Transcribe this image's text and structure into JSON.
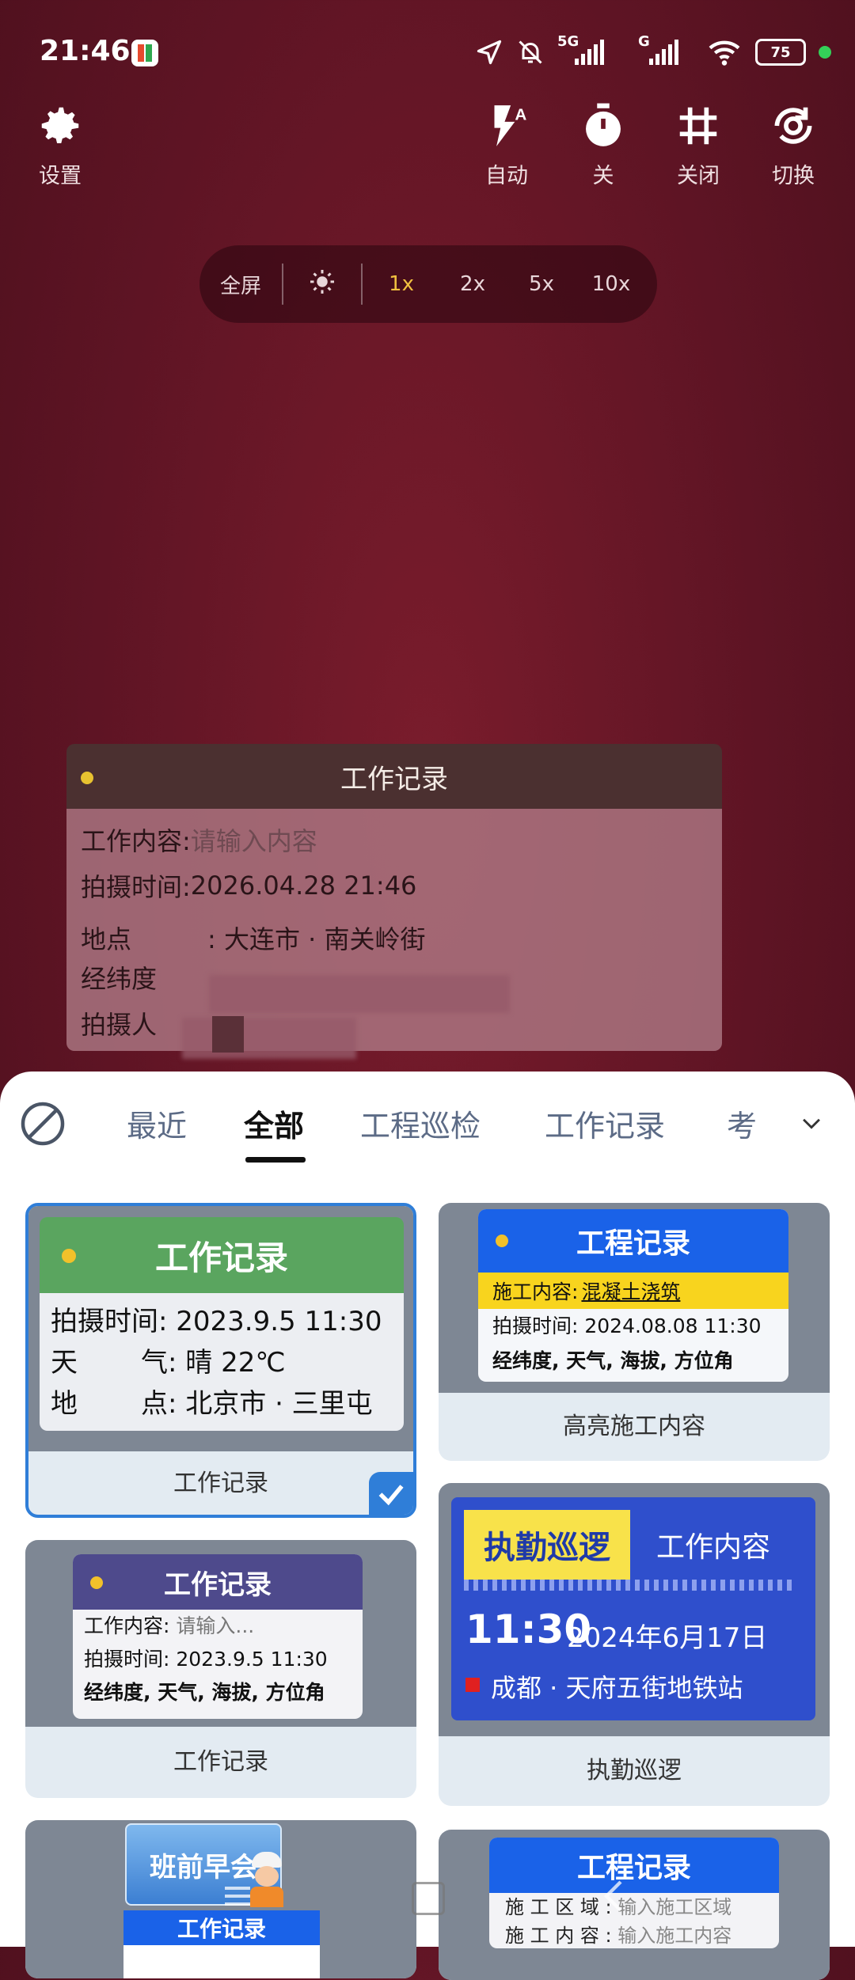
{
  "status_bar": {
    "time": "21:46",
    "net1": "5G",
    "net2": "G",
    "battery": "75"
  },
  "toolbar": {
    "settings": "设置",
    "flash": "自动",
    "timer": "关",
    "grid": "关闭",
    "switch": "切换"
  },
  "zoom": {
    "fullscreen": "全屏",
    "levels": [
      "1x",
      "2x",
      "5x",
      "10x"
    ],
    "selected": "1x"
  },
  "watermark": {
    "title": "工作记录",
    "content_label": "工作内容:",
    "content_placeholder": "请输入内容",
    "time_label": "拍摄时间:",
    "time_value": "2026.04.28 21:46",
    "place_label": "地点",
    "place_value": ": 大连市 · 南关岭街",
    "coords_label": "经纬度",
    "photographer_label": "拍摄人"
  },
  "tabs": [
    "最近",
    "全部",
    "工程巡检",
    "工作记录",
    "考"
  ],
  "active_tab": "全部",
  "templates": {
    "card1": {
      "title": "工作记录",
      "r1": "拍摄时间: 2023.9.5 11:30",
      "r2k": "天",
      "r2v": "气: 晴 22℃",
      "r3k": "地",
      "r3v": "点: 北京市 · 三里屯",
      "caption": "工作记录"
    },
    "card2": {
      "title": "工程记录",
      "hl_label": "施工内容:",
      "hl_value": "混凝土浇筑",
      "r1": "拍摄时间: 2024.08.08 11:30",
      "r2": "经纬度, 天气, 海拔, 方位角",
      "caption": "高亮施工内容"
    },
    "card3": {
      "title": "工作记录",
      "r1k": "工作内容:",
      "r1v": "请输入...",
      "r2": "拍摄时间: 2023.9.5 11:30",
      "r3": "经纬度, 天气, 海拔, 方位角",
      "caption": "工作记录"
    },
    "card4": {
      "title": "执勤巡逻",
      "right": "工作内容",
      "time": "11:30",
      "date": "2024年6月17日",
      "place": "成都 · 天府五街地铁站",
      "caption": "执勤巡逻"
    },
    "card5": {
      "badge": "班前早会",
      "title": "工作记录"
    },
    "card6": {
      "title": "工程记录",
      "r1k": "施 工 区 域 :",
      "r1v": "输入施工区域",
      "r2k": "施 工 内 容 :",
      "r2v": "输入施工内容"
    }
  },
  "colors": {
    "accent": "#2f7ed8",
    "green_header": "#5aa55f",
    "blue_header": "#1a62e8"
  }
}
